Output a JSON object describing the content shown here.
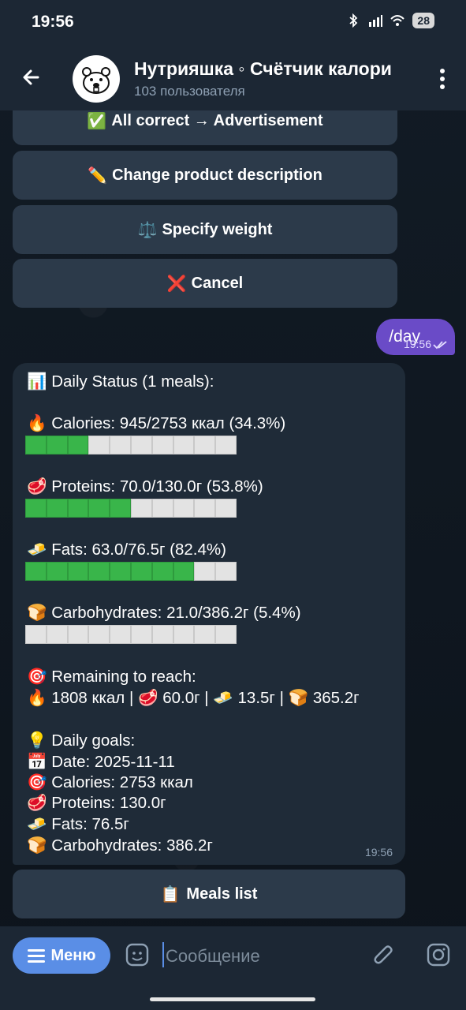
{
  "status_bar": {
    "time": "19:56",
    "battery": "28"
  },
  "header": {
    "title": "Нутрияшка ◦ Счётчик калори",
    "subtitle": "103 пользователя"
  },
  "keyboard_top": [
    {
      "emoji": "✅",
      "label": "All correct → Advertisement"
    },
    {
      "emoji": "✏️",
      "label": "Change product description"
    },
    {
      "emoji": "⚖️",
      "label": "Specify weight"
    },
    {
      "emoji": "❌",
      "label": "Cancel"
    }
  ],
  "outgoing": {
    "text": "/day",
    "time": "19:56"
  },
  "daily": {
    "header": "📊 Daily Status (1 meals):",
    "calories": {
      "text": "🔥 Calories: 945/2753 ккал (34.3%)",
      "progress": 0.343,
      "filled_cells": 3
    },
    "proteins": {
      "text": "🥩 Proteins: 70.0/130.0г (53.8%)",
      "progress": 0.538,
      "filled_cells": 5
    },
    "fats": {
      "text": "🧈 Fats: 63.0/76.5г (82.4%)",
      "progress": 0.824,
      "filled_cells": 8
    },
    "carbs": {
      "text": "🍞 Carbohydrates: 21.0/386.2г (5.4%)",
      "progress": 0.054,
      "filled_cells": 0
    },
    "remaining_title": "🎯 Remaining to reach:",
    "remaining_values": "🔥 1808 ккал | 🥩 60.0г | 🧈 13.5г | 🍞 365.2г",
    "goals_title": "💡 Daily goals:",
    "goal_date": "📅 Date: 2025-11-11",
    "goal_calories": "🎯 Calories: 2753 ккал",
    "goal_proteins": "🥩 Proteins: 130.0г",
    "goal_fats": "🧈 Fats: 76.5г",
    "goal_carbs": "🍞 Carbohydrates: 386.2г",
    "time": "19:56"
  },
  "meals_button": {
    "emoji": "📋",
    "label": "Meals list"
  },
  "input": {
    "menu_label": "Меню",
    "placeholder": "Сообщение"
  },
  "colors": {
    "accent": "#5a8ee6",
    "outgoing_bubble": "#6a4bc7",
    "bar_filled": "#39b54a",
    "bar_empty": "#e3e3e3"
  }
}
